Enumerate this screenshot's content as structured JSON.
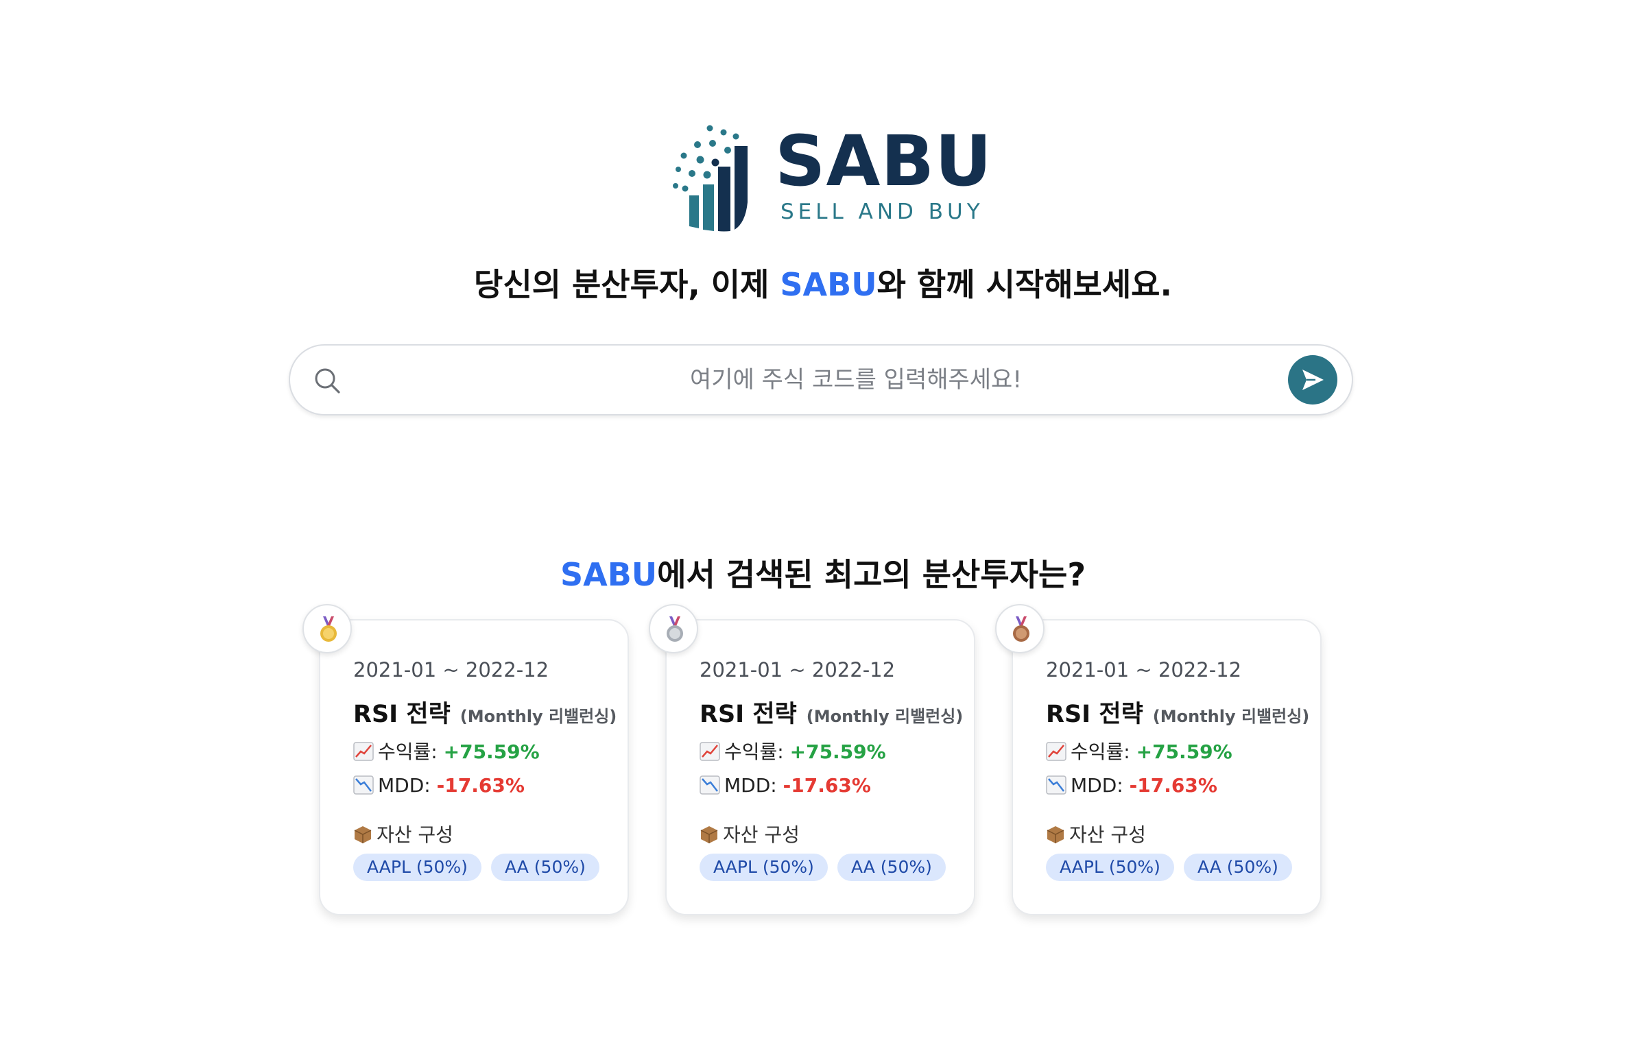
{
  "logo": {
    "title": "SABU",
    "subtitle": "SELL AND BUY"
  },
  "headline": {
    "before": "당신의 분산투자, 이제 ",
    "accent": "SABU",
    "after": "와 함께 시작해보세요."
  },
  "search": {
    "placeholder": "여기에 주식 코드를 입력해주세요!",
    "value": ""
  },
  "section": {
    "accent": "SABU",
    "title": "에서 검색된 최고의 분산투자는?"
  },
  "colors": {
    "accent": "#2f6ff1",
    "brand_dark": "#14304f",
    "brand_teal": "#2b7486",
    "positive": "#25a244",
    "negative": "#e53a33",
    "tag_bg": "#dbe7fd"
  },
  "cards": [
    {
      "medal": "gold-medal-icon",
      "period": "2021-01 ~ 2022-12",
      "strategy": "RSI 전략",
      "rebalance": "(Monthly 리밸런싱)",
      "return_label": "수익률:",
      "return_value": "+75.59%",
      "mdd_label": "MDD:",
      "mdd_value": "-17.63%",
      "assets_label": "자산 구성",
      "assets": [
        "AAPL (50%)",
        "AA (50%)"
      ]
    },
    {
      "medal": "silver-medal-icon",
      "period": "2021-01 ~ 2022-12",
      "strategy": "RSI 전략",
      "rebalance": "(Monthly 리밸런싱)",
      "return_label": "수익률:",
      "return_value": "+75.59%",
      "mdd_label": "MDD:",
      "mdd_value": "-17.63%",
      "assets_label": "자산 구성",
      "assets": [
        "AAPL (50%)",
        "AA (50%)"
      ]
    },
    {
      "medal": "bronze-medal-icon",
      "period": "2021-01 ~ 2022-12",
      "strategy": "RSI 전략",
      "rebalance": "(Monthly 리밸런싱)",
      "return_label": "수익률:",
      "return_value": "+75.59%",
      "mdd_label": "MDD:",
      "mdd_value": "-17.63%",
      "assets_label": "자산 구성",
      "assets": [
        "AAPL (50%)",
        "AA (50%)"
      ]
    }
  ]
}
